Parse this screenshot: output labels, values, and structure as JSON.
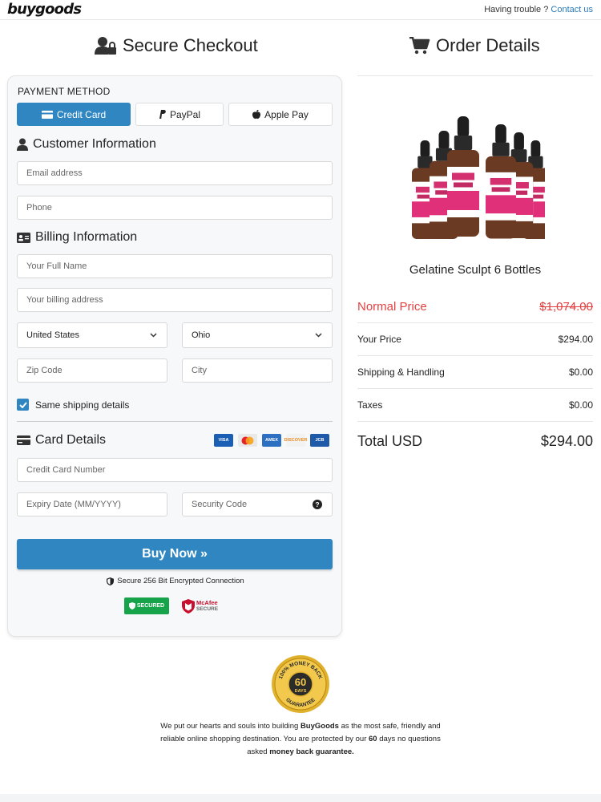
{
  "header": {
    "logo": "buygoods",
    "help_text": "Having trouble ?",
    "help_link": "Contact us"
  },
  "checkout": {
    "title": "Secure Checkout",
    "payment_method_label": "PAYMENT METHOD",
    "methods": [
      {
        "label": "Credit Card",
        "active": true
      },
      {
        "label": "PayPal",
        "active": false
      },
      {
        "label": "Apple Pay",
        "active": false
      }
    ],
    "customer_title": "Customer Information",
    "email_placeholder": "Email address",
    "phone_placeholder": "Phone",
    "billing_title": "Billing Information",
    "name_placeholder": "Your Full Name",
    "address_placeholder": "Your billing address",
    "country": "United States",
    "state": "Ohio",
    "zip_placeholder": "Zip Code",
    "city_placeholder": "City",
    "same_shipping_label": "Same shipping details",
    "same_shipping_checked": true,
    "card_title": "Card Details",
    "card_brands": [
      {
        "name": "VISA",
        "color": "#1a5fb4"
      },
      {
        "name": "mastercard",
        "color": "#e35a2a"
      },
      {
        "name": "AMEX",
        "color": "#2d6fc0"
      },
      {
        "name": "DISCOVER",
        "color": "#f08a1d"
      },
      {
        "name": "JCB",
        "color": "#1e5aa8"
      }
    ],
    "card_number_placeholder": "Credit Card Number",
    "expiry_placeholder": "Expiry Date (MM/YYYY)",
    "security_placeholder": "Security Code",
    "buy_label": "Buy Now »",
    "secure_text": "Secure 256 Bit Encrypted Connection",
    "badge_secured": "SECURED",
    "badge_mcafee_1": "McAfee",
    "badge_mcafee_2": "SECURE"
  },
  "order": {
    "title": "Order Details",
    "product_name": "Gelatine Sculpt 6 Bottles",
    "normal_label": "Normal Price",
    "normal_value": "$1,074.00",
    "price_label": "Your Price",
    "price_value": "$294.00",
    "shipping_label": "Shipping & Handling",
    "shipping_value": "$0.00",
    "taxes_label": "Taxes",
    "taxes_value": "$0.00",
    "total_label": "Total USD",
    "total_value": "$294.00"
  },
  "guarantee": {
    "badge_top": "100% MONEY BACK",
    "badge_days": "60",
    "badge_days_label": "DAYS",
    "badge_bottom": "GUARANTEE",
    "text_1": "We put our hearts and souls into building ",
    "text_brand": "BuyGoods",
    "text_2": " as the most safe, friendly and reliable online shopping destination. You are protected by our ",
    "text_days": "60",
    "text_3": " days no questions asked ",
    "text_mbg": "money back guarantee."
  },
  "colors": {
    "primary": "#2f86c1",
    "normal_price": "#e34141",
    "link": "#2a7ab8"
  }
}
